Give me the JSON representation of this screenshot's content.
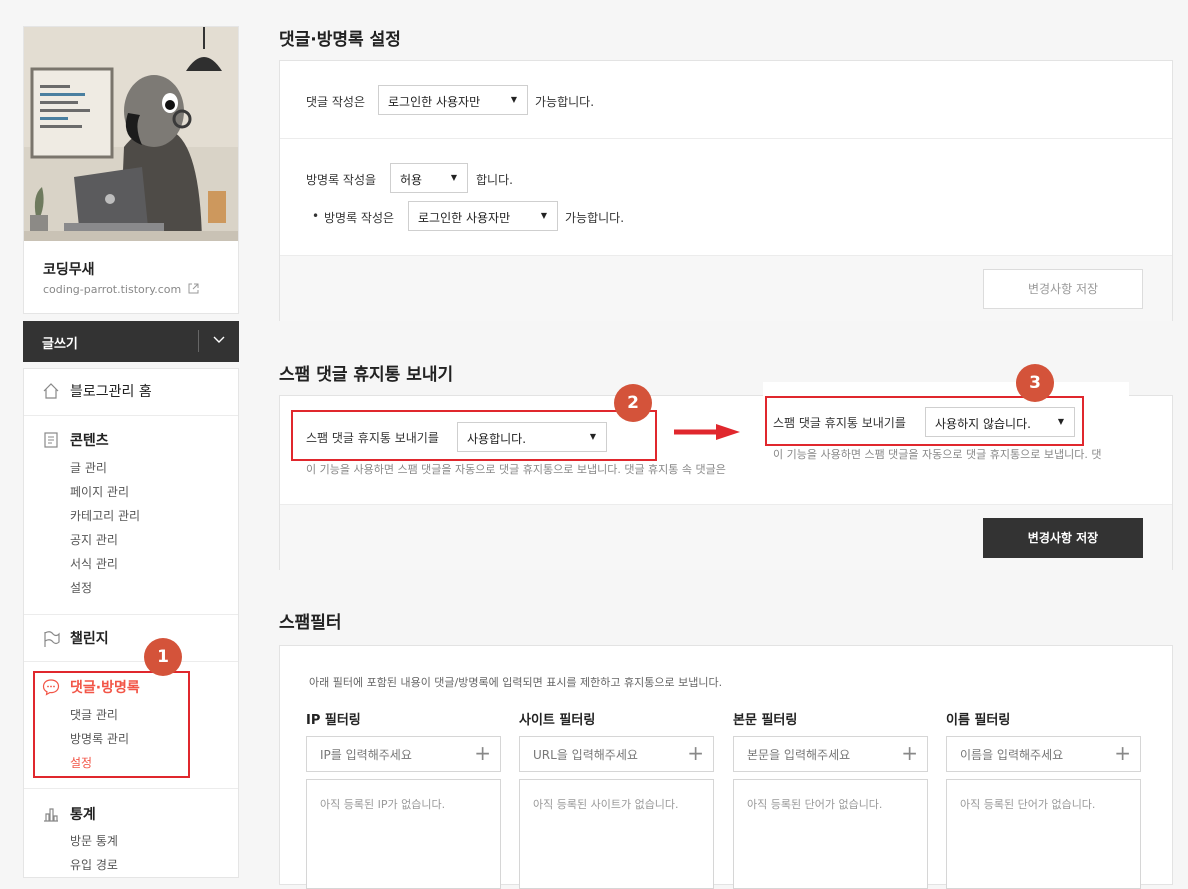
{
  "sidebar": {
    "blog_name": "코딩무새",
    "blog_url": "coding-parrot.tistory.com",
    "write_label": "글쓰기",
    "home_label": "블로그관리 홈",
    "contents": {
      "label": "콘텐츠",
      "items": [
        "글 관리",
        "페이지 관리",
        "카테고리 관리",
        "공지 관리",
        "서식 관리",
        "설정"
      ]
    },
    "challenge_label": "챌린지",
    "comments": {
      "label": "댓글·방명록",
      "items": [
        "댓글 관리",
        "방명록 관리",
        "설정"
      ]
    },
    "stats": {
      "label": "통계",
      "items": [
        "방문 통계",
        "유입 경로"
      ]
    }
  },
  "section1": {
    "title": "댓글·방명록 설정",
    "comment_prefix": "댓글 작성은",
    "comment_select": "로그인한 사용자만",
    "comment_suffix": "가능합니다.",
    "guestbook_prefix": "방명록 작성을",
    "guestbook_select": "허용",
    "guestbook_suffix": "합니다.",
    "guestbook_write_prefix": "방명록 작성은",
    "guestbook_write_select": "로그인한 사용자만",
    "guestbook_write_suffix": "가능합니다.",
    "save_label": "변경사항 저장"
  },
  "section2": {
    "title": "스팸 댓글 휴지통 보내기",
    "label": "스팸 댓글 휴지통 보내기를",
    "select_before": "사용합니다.",
    "select_after": "사용하지 않습니다.",
    "desc_before": "이 기능을 사용하면 스팸 댓글을 자동으로 댓글 휴지통으로 보냅니다. 댓글 휴지통 속 댓글은",
    "desc_after": "이 기능을 사용하면 스팸 댓글을 자동으로 댓글 휴지통으로 보냅니다. 댓",
    "save_label": "변경사항 저장"
  },
  "section3": {
    "title": "스팸필터",
    "desc": "아래 필터에 포함된 내용이 댓글/방명록에 입력되면 표시를 제한하고 휴지통으로 보냅니다.",
    "filters": [
      {
        "title": "IP 필터링",
        "placeholder": "IP를 입력해주세요",
        "empty": "아직 등록된 IP가 없습니다."
      },
      {
        "title": "사이트 필터링",
        "placeholder": "URL을 입력해주세요",
        "empty": "아직 등록된 사이트가 없습니다."
      },
      {
        "title": "본문 필터링",
        "placeholder": "본문을 입력해주세요",
        "empty": "아직 등록된 단어가 없습니다."
      },
      {
        "title": "이름 필터링",
        "placeholder": "이름을 입력해주세요",
        "empty": "아직 등록된 단어가 없습니다."
      }
    ]
  },
  "annotations": {
    "badge1": "1",
    "badge2": "2",
    "badge3": "3"
  },
  "colors": {
    "accent": "#f25547",
    "annotation_red": "#e0272d",
    "badge": "#d4533a",
    "dark_button": "#333333"
  }
}
